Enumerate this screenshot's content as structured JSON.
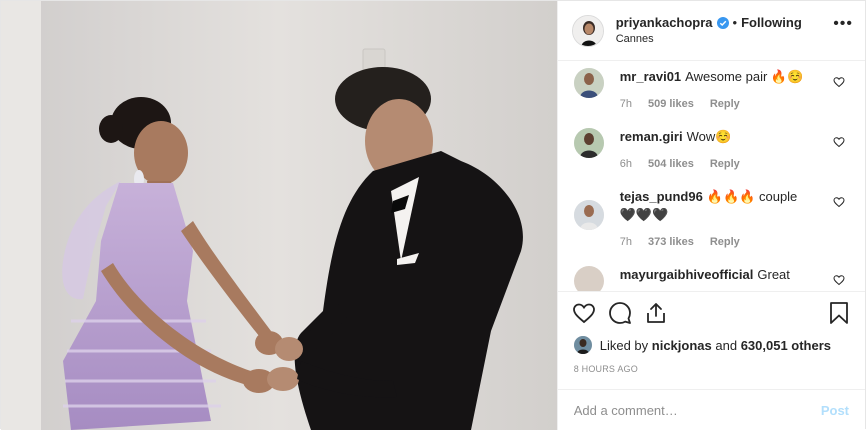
{
  "header": {
    "username": "priyankachopra",
    "separator": "•",
    "follow_status": "Following",
    "location": "Cannes",
    "more_label": "•••"
  },
  "comments": [
    {
      "username": "mr_ravi01",
      "text": "Awesome pair 🔥☺️",
      "time": "7h",
      "likes": "509 likes",
      "reply": "Reply"
    },
    {
      "username": "reman.giri",
      "text": "Wow☺️",
      "time": "6h",
      "likes": "504 likes",
      "reply": "Reply"
    },
    {
      "username": "tejas_pund96",
      "text": "🔥🔥🔥 couple 🖤🖤🖤",
      "time": "7h",
      "likes": "373 likes",
      "reply": "Reply"
    },
    {
      "username": "mayurgaibhiveofficial",
      "text": "Great",
      "time": "",
      "likes": "",
      "reply": ""
    }
  ],
  "likes": {
    "prefix": "Liked by",
    "user": "nickjonas",
    "joiner": "and",
    "count": "630,051 others"
  },
  "timeago": "8 HOURS AGO",
  "add_comment": {
    "placeholder": "Add a comment…",
    "post_label": "Post"
  },
  "colors": {
    "verified": "#3897f0",
    "post_disabled": "#b2dffc",
    "meta_gray": "#8e8e8e"
  },
  "icons": [
    "more-icon",
    "verified-badge-icon",
    "heart-icon",
    "comment-icon",
    "share-icon",
    "bookmark-icon"
  ]
}
